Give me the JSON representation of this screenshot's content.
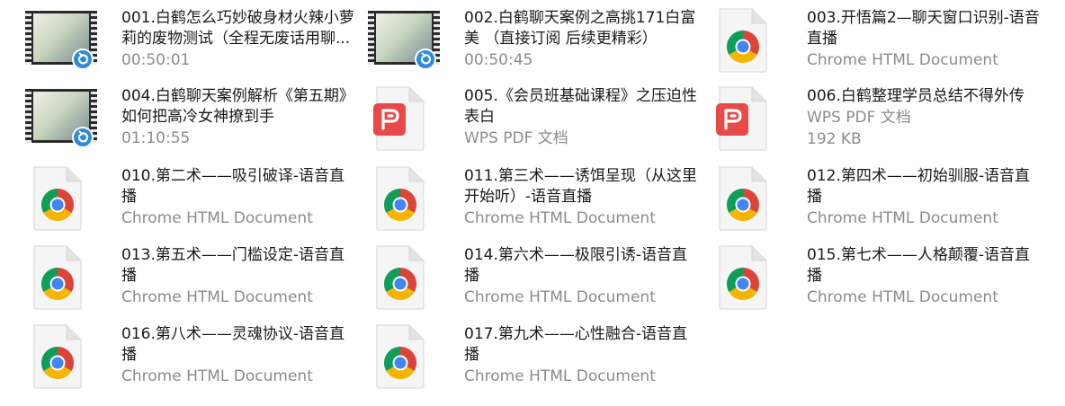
{
  "colors": {
    "pdf_red": "#e84a4a",
    "video_badge_blue": "#2f8bd8",
    "name_text": "#1a1a1a",
    "meta_text": "#8c8c8c"
  },
  "files": [
    {
      "name": "001.白鹤怎么巧妙破身材火辣小萝莉的废物测试（全程无废话用聊...",
      "meta": "00:50:01",
      "kind": "video",
      "icon": "video-thumbnail-icon"
    },
    {
      "name": "002.白鹤聊天案例之高挑171白富美 （直接订阅 后续更精彩）",
      "meta": "00:50:45",
      "kind": "video",
      "icon": "video-thumbnail-icon"
    },
    {
      "name": "003.开悟篇2—聊天窗口识别-语音直播",
      "meta": "Chrome HTML Document",
      "kind": "chrome",
      "icon": "chrome-html-document-icon"
    },
    {
      "name": "004.白鹤聊天案例解析《第五期》如何把高冷女神撩到手",
      "meta": "01:10:55",
      "kind": "video",
      "icon": "video-thumbnail-icon"
    },
    {
      "name": "005.《会员班基础课程》之压迫性表白",
      "meta": "WPS PDF 文档",
      "kind": "pdf",
      "icon": "wps-pdf-document-icon"
    },
    {
      "name": "006.白鹤整理学员总结不得外传",
      "meta": "WPS PDF 文档",
      "meta2": "192 KB",
      "kind": "pdf",
      "icon": "wps-pdf-document-icon"
    },
    {
      "name": "010.第二术——吸引破译-语音直播",
      "meta": "Chrome HTML Document",
      "kind": "chrome",
      "icon": "chrome-html-document-icon"
    },
    {
      "name": "011.第三术——诱饵呈现（从这里开始听）-语音直播",
      "meta": "Chrome HTML Document",
      "kind": "chrome",
      "icon": "chrome-html-document-icon"
    },
    {
      "name": "012.第四术——初始驯服-语音直播",
      "meta": "Chrome HTML Document",
      "kind": "chrome",
      "icon": "chrome-html-document-icon"
    },
    {
      "name": "013.第五术——门槛设定-语音直播",
      "meta": "Chrome HTML Document",
      "kind": "chrome",
      "icon": "chrome-html-document-icon"
    },
    {
      "name": "014.第六术——极限引诱-语音直播",
      "meta": "Chrome HTML Document",
      "kind": "chrome",
      "icon": "chrome-html-document-icon"
    },
    {
      "name": "015.第七术——人格颠覆-语音直播",
      "meta": "Chrome HTML Document",
      "kind": "chrome",
      "icon": "chrome-html-document-icon"
    },
    {
      "name": "016.第八术——灵魂协议-语音直播",
      "meta": "Chrome HTML Document",
      "kind": "chrome",
      "icon": "chrome-html-document-icon"
    },
    {
      "name": "017.第九术——心性融合-语音直播",
      "meta": "Chrome HTML Document",
      "kind": "chrome",
      "icon": "chrome-html-document-icon"
    }
  ]
}
